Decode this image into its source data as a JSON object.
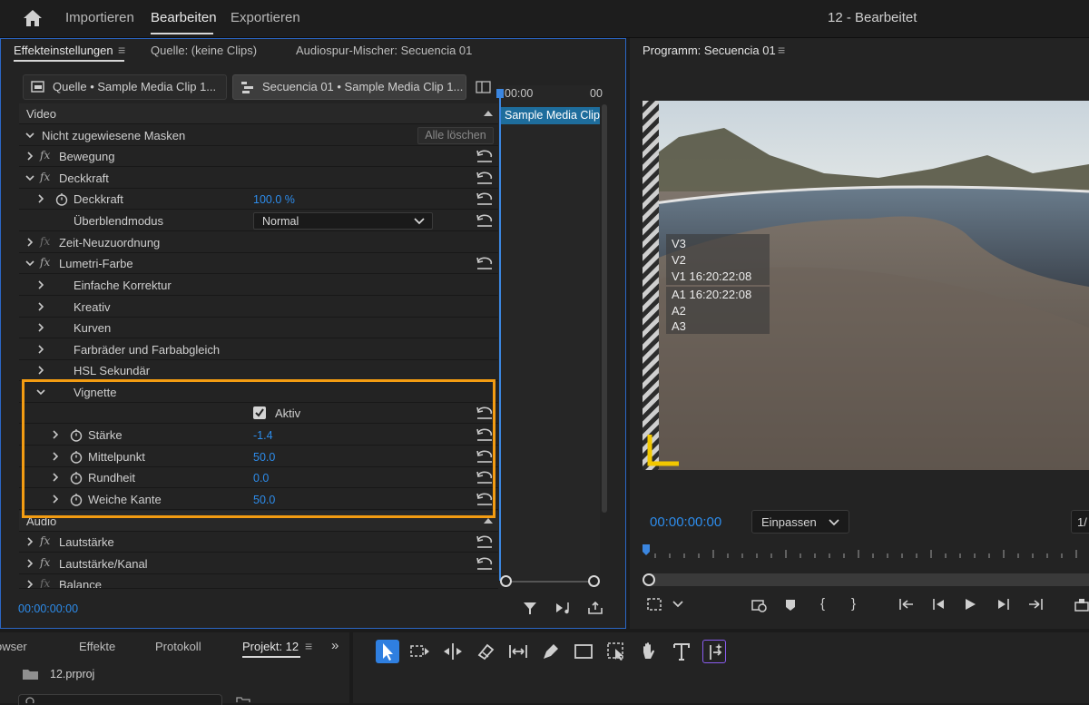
{
  "topbar": {
    "home_icon": "home-icon",
    "nav": [
      "Importieren",
      "Bearbeiten",
      "Exportieren"
    ],
    "active_nav": "Bearbeiten",
    "project_title": "12 - Bearbeitet"
  },
  "effects_panel": {
    "tabs": [
      "Effekteinstellungen",
      "Quelle: (keine Clips)",
      "Audiospur-Mischer: Secuencia 01"
    ],
    "source_clip": "Quelle • Sample Media Clip 1...",
    "sequence_clip": "Secuencia 01 • Sample Media Clip 1...",
    "timeline_time": "00:00",
    "timeline_time2": "00",
    "clip_label": "Sample Media Clip",
    "video_header": "Video",
    "masks_label": "Nicht zugewiesene Masken",
    "clear_all": "Alle löschen",
    "bewegung": "Bewegung",
    "deckkraft_group": "Deckkraft",
    "deckkraft_prop": "Deckkraft",
    "deckkraft_value": "100.0 %",
    "blend_label": "Überblendmodus",
    "blend_value": "Normal",
    "zeit": "Zeit-Neuzuordnung",
    "lumetri": "Lumetri-Farbe",
    "lumetri_sections": [
      "Einfache Korrektur",
      "Kreativ",
      "Kurven",
      "Farbräder und Farbabgleich",
      "HSL Sekundär"
    ],
    "vignette": "Vignette",
    "aktiv_label": "Aktiv",
    "vignette_props": [
      {
        "label": "Stärke",
        "value": "-1.4"
      },
      {
        "label": "Mittelpunkt",
        "value": "50.0"
      },
      {
        "label": "Rundheit",
        "value": "0.0"
      },
      {
        "label": "Weiche Kante",
        "value": "50.0"
      }
    ],
    "audio_header": "Audio",
    "audio_effects": [
      "Lautstärke",
      "Lautstärke/Kanal",
      "Balance"
    ],
    "timecode": "00:00:00:00"
  },
  "program_monitor": {
    "title": "Programm: Secuencia 01",
    "overlay_video": [
      "V3",
      "V2",
      "V1 16:20:22:08"
    ],
    "overlay_audio": [
      "A1 16:20:22:08",
      "A2",
      "A3"
    ],
    "timecode": "00:00:00:00",
    "fit": "Einpassen",
    "resolution_partial": "1/"
  },
  "project_panel": {
    "tabs": [
      "Browser",
      "Effekte",
      "Protokoll",
      "Projekt: 12"
    ],
    "file": "12.prproj"
  },
  "colors": {
    "accent_blue": "#2d8ceb",
    "highlight_orange": "#f39c12",
    "panel_bg": "#232323",
    "clip_blue": "#1e6d9c"
  }
}
